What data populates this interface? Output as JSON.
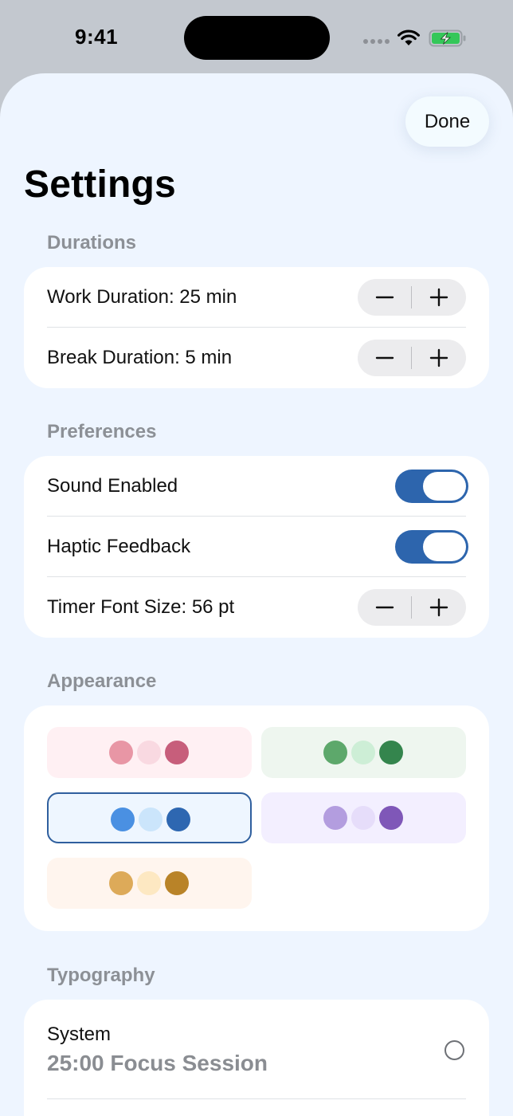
{
  "status_bar": {
    "time": "9:41",
    "icons": [
      "cellular-signal-icon",
      "wifi-icon",
      "battery-charging-icon"
    ],
    "battery_color": "#34c759"
  },
  "header": {
    "done_label": "Done",
    "title": "Settings"
  },
  "sections": {
    "durations": {
      "header": "Durations",
      "work_label": "Work Duration: 25 min",
      "break_label": "Break Duration: 5 min"
    },
    "preferences": {
      "header": "Preferences",
      "sound_label": "Sound Enabled",
      "sound_on": true,
      "haptic_label": "Haptic Feedback",
      "haptic_on": true,
      "font_size_label": "Timer Font Size: 56 pt"
    },
    "appearance": {
      "header": "Appearance",
      "themes": [
        {
          "name": "pink",
          "background": "#fff0f3",
          "colors": [
            "#e896a5",
            "#f9d9e1",
            "#c75e7b"
          ],
          "selected": false
        },
        {
          "name": "green",
          "background": "#eef6ef",
          "colors": [
            "#5da86b",
            "#cdeed6",
            "#34854d"
          ],
          "selected": false
        },
        {
          "name": "blue",
          "background": "#eef6ff",
          "colors": [
            "#4a90e2",
            "#cbe5fb",
            "#2e67b1"
          ],
          "selected": true
        },
        {
          "name": "purple",
          "background": "#f3efff",
          "colors": [
            "#b39ddf",
            "#e6ddfa",
            "#7f57b8"
          ],
          "selected": false
        },
        {
          "name": "orange",
          "background": "#fff5ee",
          "colors": [
            "#ddaa59",
            "#fde8c2",
            "#b98328"
          ],
          "selected": false
        }
      ]
    },
    "typography": {
      "header": "Typography",
      "font_name": "System",
      "sample_text": "25:00 Focus Session",
      "selected": false
    }
  },
  "colors": {
    "accent": "#2d65ad",
    "sheet_background": "#eef5ff",
    "section_header": "#8c9096"
  }
}
